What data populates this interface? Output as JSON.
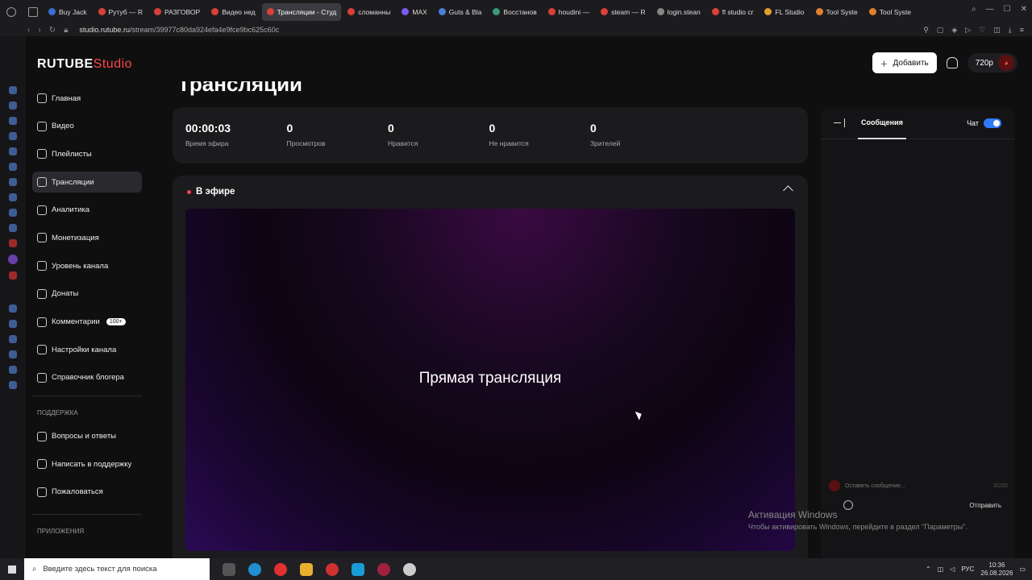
{
  "browser": {
    "tabs": [
      {
        "label": "Buy Jack",
        "color": "#3b6fd6"
      },
      {
        "label": "Рутуб — R",
        "color": "#d9403a"
      },
      {
        "label": "РАЗГОВОР",
        "color": "#d9403a"
      },
      {
        "label": "Видео нед",
        "color": "#d9403a"
      },
      {
        "label": "Трансляции - Студ",
        "color": "#d9403a"
      },
      {
        "label": "сломанны",
        "color": "#d9403a"
      },
      {
        "label": "MAX",
        "color": "#7a5af0"
      },
      {
        "label": "Guts & Bla",
        "color": "#4a7fd9"
      },
      {
        "label": "Восстанов",
        "color": "#3a9a7a"
      },
      {
        "label": "houdini —",
        "color": "#d9403a"
      },
      {
        "label": "steam — R",
        "color": "#d9403a"
      },
      {
        "label": "login.stean",
        "color": "#888888"
      },
      {
        "label": "fl studio cr",
        "color": "#d9403a"
      },
      {
        "label": "FL Studio",
        "color": "#e0a030"
      },
      {
        "label": "Tool Syste",
        "color": "#e08030"
      },
      {
        "label": "Tool Syste",
        "color": "#e08030"
      }
    ],
    "active_tab": 4,
    "url_domain": "studio.rutube.ru",
    "url_path": "/stream/39977c80da924efa4e9fce9bc625c60c"
  },
  "header": {
    "logo_main": "RUTUBE",
    "logo_studio": "Studio",
    "add_label": "Добавить",
    "quality": "720p"
  },
  "nav": {
    "items": [
      {
        "label": "Главная",
        "icon": "home-icon"
      },
      {
        "label": "Видео",
        "icon": "video-icon"
      },
      {
        "label": "Плейлисты",
        "icon": "playlist-icon"
      },
      {
        "label": "Трансляции",
        "icon": "broadcast-icon"
      },
      {
        "label": "Аналитика",
        "icon": "analytics-icon"
      },
      {
        "label": "Монетизация",
        "icon": "money-icon"
      },
      {
        "label": "Уровень канала",
        "icon": "level-icon"
      },
      {
        "label": "Донаты",
        "icon": "donate-icon"
      },
      {
        "label": "Комментарии",
        "icon": "comments-icon"
      },
      {
        "label": "Настройки канала",
        "icon": "settings-icon"
      },
      {
        "label": "Справочник блогера",
        "icon": "info-icon"
      }
    ],
    "comments_badge": "100+",
    "support_title": "ПОДДЕРЖКА",
    "support_items": [
      {
        "label": "Вопросы и ответы",
        "icon": "help-icon"
      },
      {
        "label": "Написать в поддержку",
        "icon": "mail-icon"
      },
      {
        "label": "Пожаловаться",
        "icon": "flag-icon"
      }
    ],
    "apps_title": "ПРИЛОЖЕНИЯ"
  },
  "page": {
    "title": "Трансляции"
  },
  "stats": [
    {
      "value": "00:00:03",
      "label": "Время эфира"
    },
    {
      "value": "0",
      "label": "Просмотров"
    },
    {
      "value": "0",
      "label": "Нравится"
    },
    {
      "value": "0",
      "label": "Не нравится"
    },
    {
      "value": "0",
      "label": "Зрителей"
    }
  ],
  "live": {
    "status": "В эфире",
    "video_title": "Прямая трансляция"
  },
  "chat": {
    "tab_messages": "Сообщения",
    "toggle_label": "Чат",
    "input_placeholder": "Оставить сообщение...",
    "counter": "0/200",
    "send_label": "Отправить"
  },
  "watermark": {
    "line1": "Активация Windows",
    "line2": "Чтобы активировать Windows, перейдите в раздел \"Параметры\"."
  },
  "taskbar": {
    "search_placeholder": "Введите здесь текст для поиска",
    "lang": "РУС",
    "time": "10:36",
    "date": "26.08.2026"
  }
}
